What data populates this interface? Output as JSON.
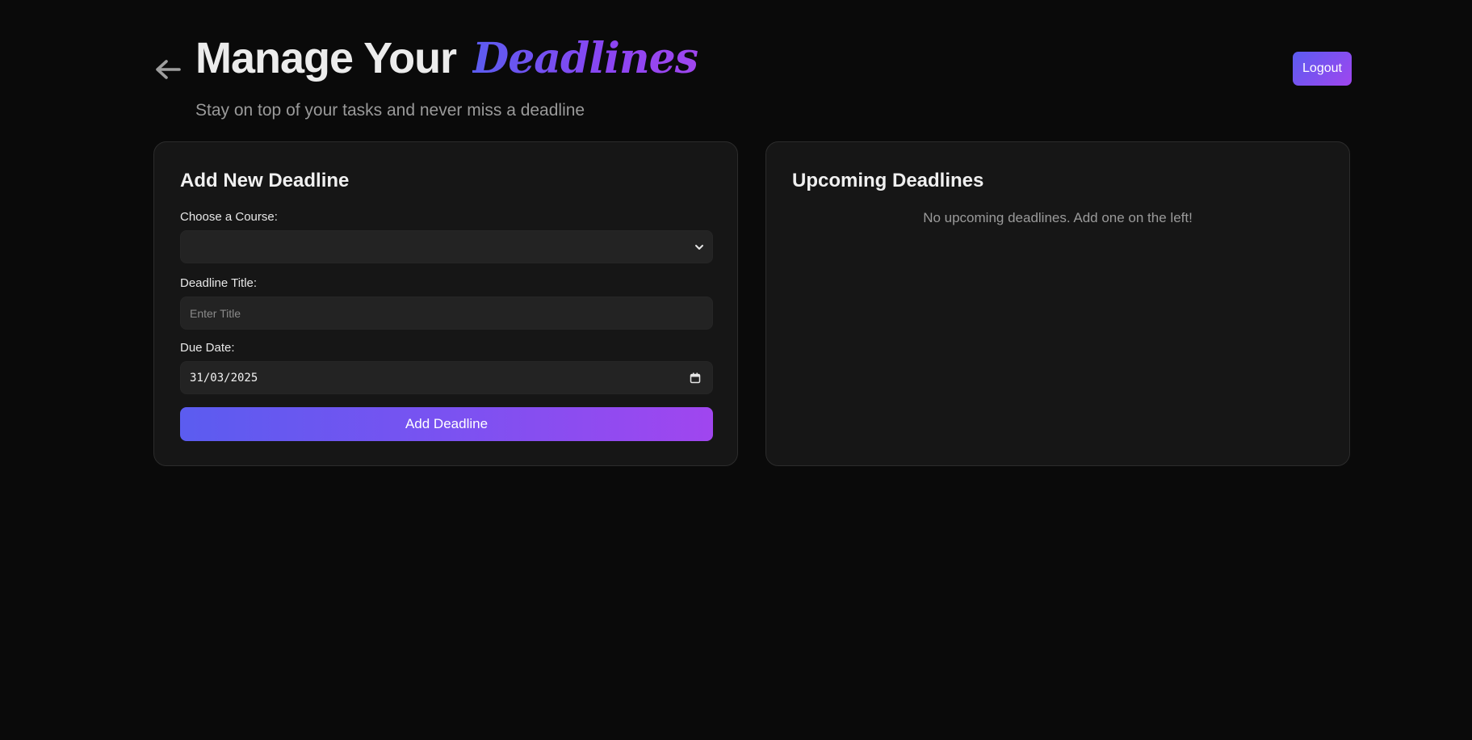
{
  "header": {
    "title_prefix": "Manage Your",
    "title_accent": "Deadlines",
    "subtitle": "Stay on top of your tasks and never miss a deadline",
    "back_icon": "arrow-left-icon",
    "logout_label": "Logout"
  },
  "form": {
    "heading": "Add New Deadline",
    "course_label": "Choose a Course:",
    "course_value": "",
    "title_label": "Deadline Title:",
    "title_value": "",
    "title_placeholder": "Enter Title",
    "date_label": "Due Date:",
    "date_value": "31/03/2025",
    "submit_label": "Add Deadline"
  },
  "upcoming": {
    "heading": "Upcoming Deadlines",
    "empty_message": "No upcoming deadlines. Add one on the left!"
  },
  "colors": {
    "background": "#0a0a0a",
    "card": "#161616",
    "accent_start": "#5b5cf0",
    "accent_end": "#a046ef"
  }
}
